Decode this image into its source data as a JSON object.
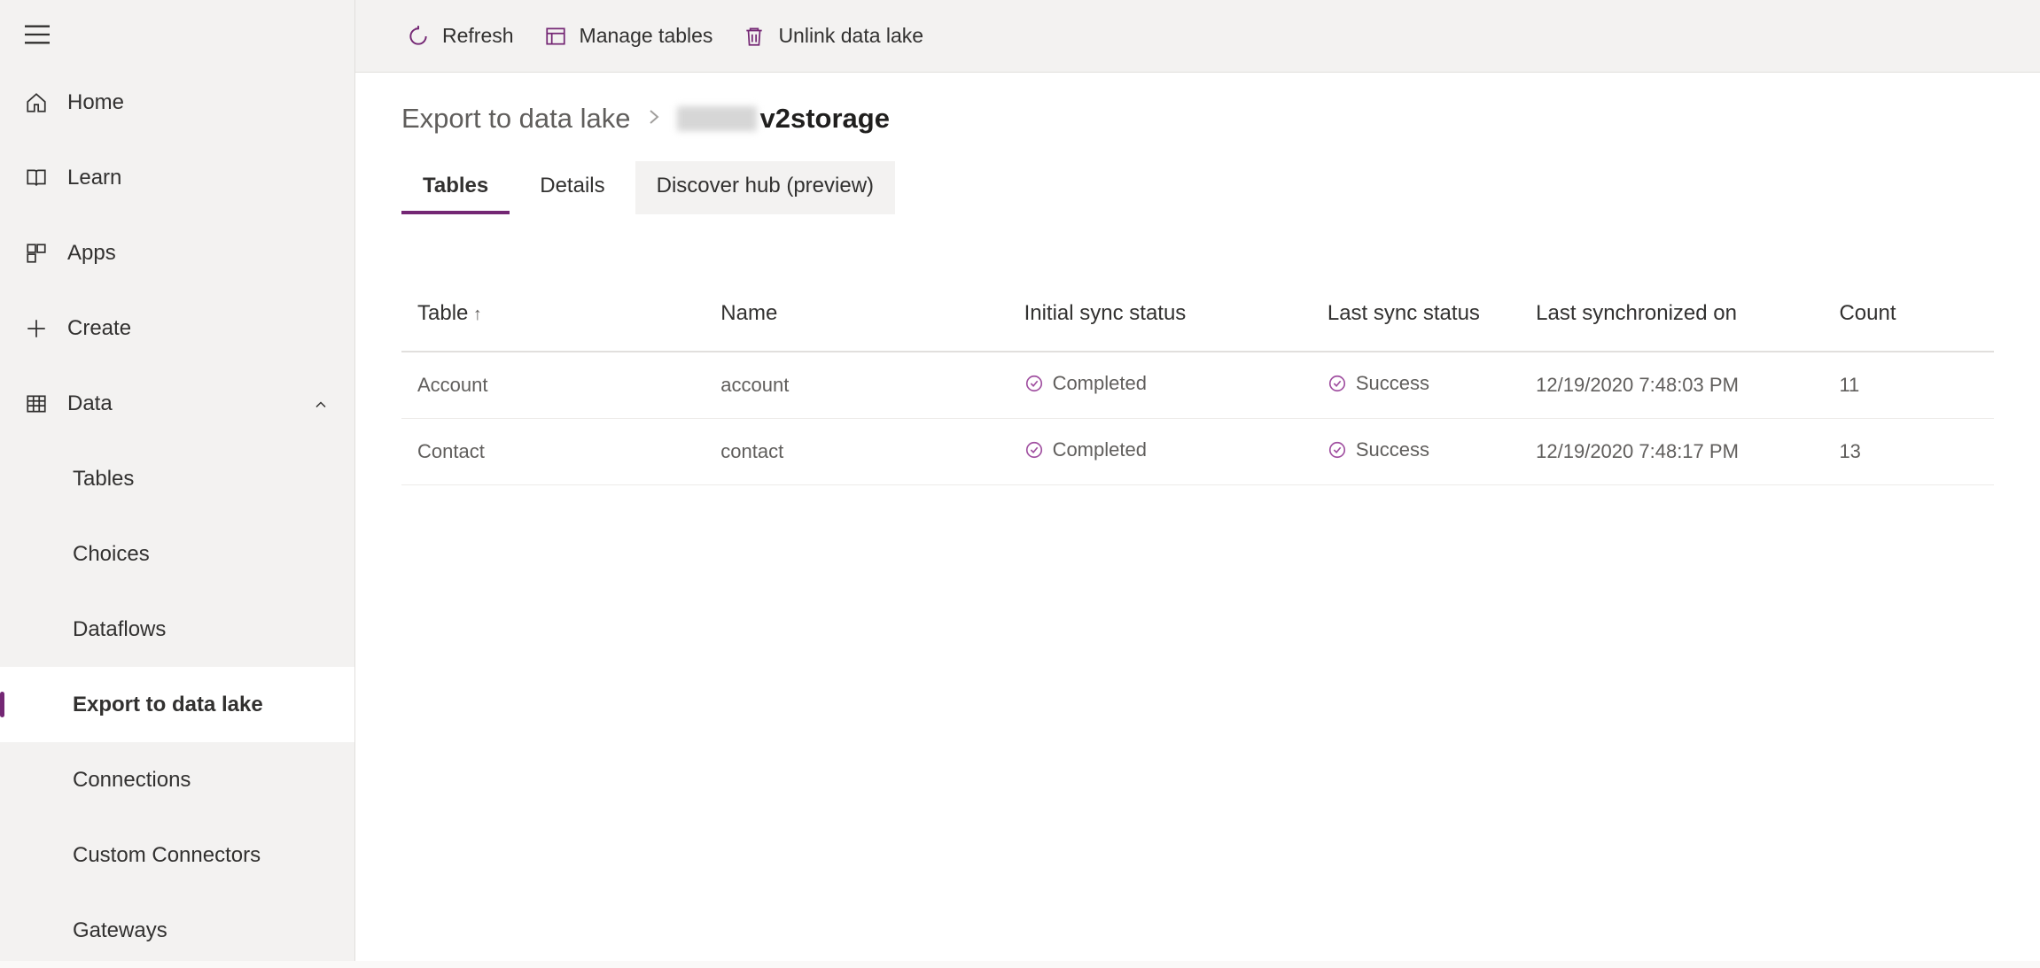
{
  "sidebar": {
    "items": [
      {
        "label": "Home",
        "icon": "home-icon"
      },
      {
        "label": "Learn",
        "icon": "book-icon"
      },
      {
        "label": "Apps",
        "icon": "grid-icon"
      },
      {
        "label": "Create",
        "icon": "plus-icon"
      },
      {
        "label": "Data",
        "icon": "table-icon",
        "expanded": true
      }
    ],
    "sub_items": [
      {
        "label": "Tables"
      },
      {
        "label": "Choices"
      },
      {
        "label": "Dataflows"
      },
      {
        "label": "Export to data lake",
        "active": true
      },
      {
        "label": "Connections"
      },
      {
        "label": "Custom Connectors"
      },
      {
        "label": "Gateways"
      }
    ]
  },
  "toolbar": {
    "refresh_label": "Refresh",
    "manage_label": "Manage tables",
    "unlink_label": "Unlink data lake"
  },
  "breadcrumb": {
    "root": "Export to data lake",
    "current_suffix": "v2storage"
  },
  "tabs": [
    {
      "label": "Tables",
      "active": true
    },
    {
      "label": "Details"
    },
    {
      "label": "Discover hub (preview)",
      "highlight": true
    }
  ],
  "table": {
    "headers": {
      "table": "Table",
      "name": "Name",
      "initial_sync": "Initial sync status",
      "last_sync": "Last sync status",
      "last_sync_on": "Last synchronized on",
      "count": "Count"
    },
    "rows": [
      {
        "table": "Account",
        "name": "account",
        "initial_sync": "Completed",
        "last_sync": "Success",
        "last_sync_on": "12/19/2020 7:48:03 PM",
        "count": "11"
      },
      {
        "table": "Contact",
        "name": "contact",
        "initial_sync": "Completed",
        "last_sync": "Success",
        "last_sync_on": "12/19/2020 7:48:17 PM",
        "count": "13"
      }
    ]
  }
}
